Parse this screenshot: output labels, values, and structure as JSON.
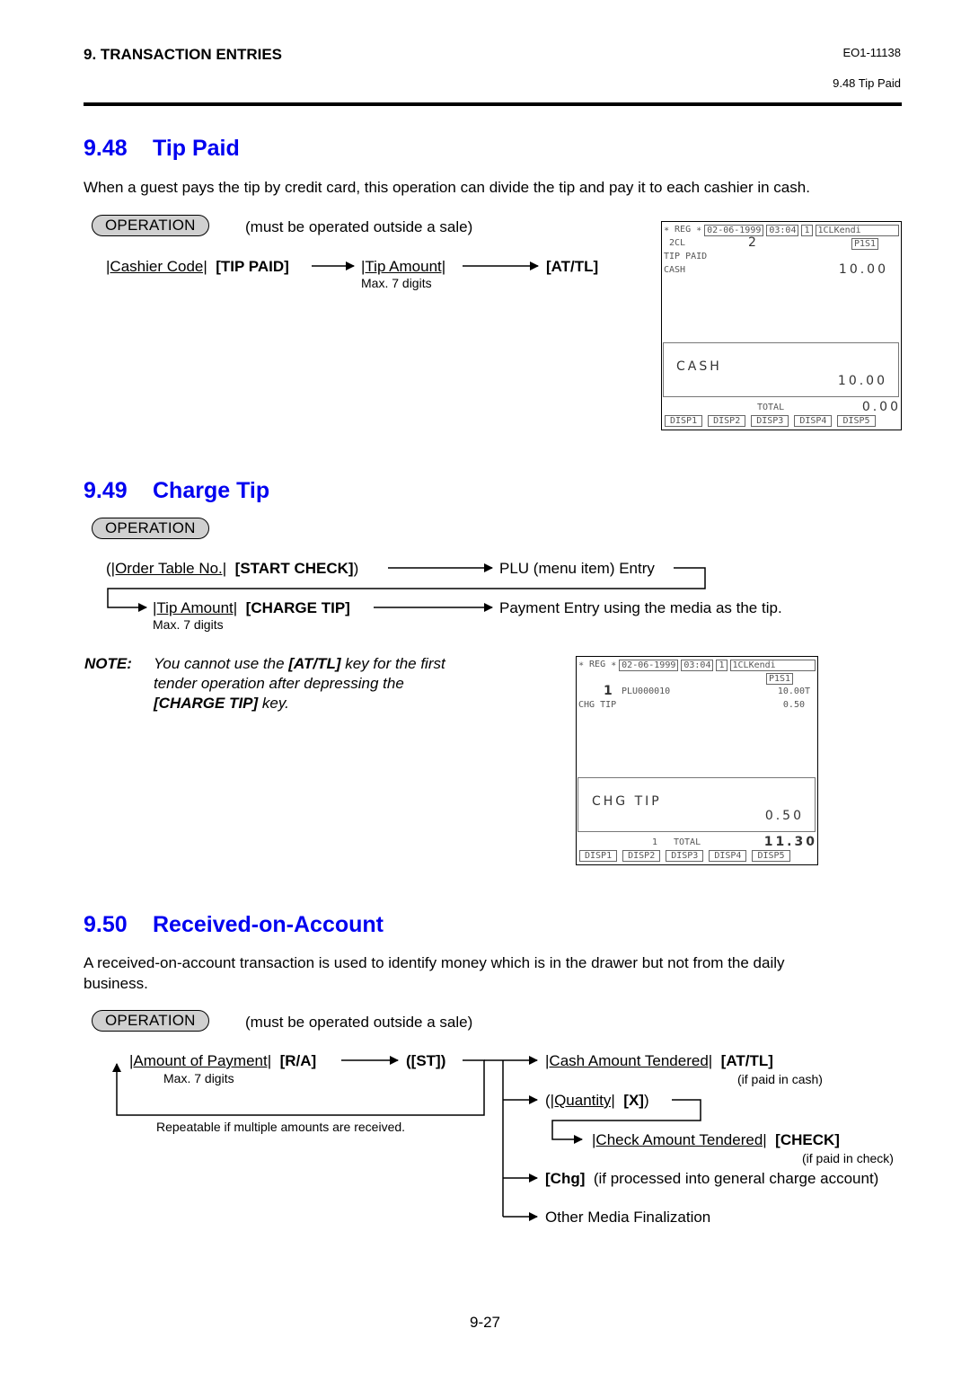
{
  "header": {
    "chapter": "9.  TRANSACTION ENTRIES",
    "doc_id": "EO1-11138",
    "section_ref": "9.48  Tip Paid"
  },
  "sections": {
    "tip_paid": {
      "number": "9.48",
      "title": "Tip Paid",
      "description": "When a guest pays the tip by credit card, this operation can divide the tip and pay it to each cashier in cash.",
      "operation_label": "OPERATION",
      "operation_note": "(must be operated outside a sale)",
      "flow": {
        "cashier_code": "|Cashier Code|",
        "tip_paid_key": "[TIP PAID]",
        "tip_amount": "|Tip Amount|",
        "max_digits": "Max. 7 digits",
        "at_tl_key": "[AT/TL]"
      },
      "screen": {
        "mode": "∗ REG ∗",
        "date": "02-06-1999",
        "time": "03:04",
        "terminal": "1",
        "cashier": "1CLKendi",
        "line1_left": "2CL",
        "line1_mid": "2",
        "line1_right": "P1S1",
        "line2": "TIP PAID",
        "line3_left": "CASH",
        "line3_right": "10.00",
        "lcd_label": "CASH",
        "lcd_value": "10.00",
        "total_label": "TOTAL",
        "total_value": "0.00",
        "disp_buttons": [
          "DISP1",
          "DISP2",
          "DISP3",
          "DISP4",
          "DISP5"
        ]
      }
    },
    "charge_tip": {
      "number": "9.49",
      "title": "Charge Tip",
      "operation_label": "OPERATION",
      "flow": {
        "open_paren": "(",
        "order_table": "|Order Table No.|",
        "start_check": "[START CHECK]",
        "close_paren": ")",
        "plu_entry": "PLU (menu item) Entry",
        "tip_amount": "|Tip Amount|",
        "charge_tip_key": "[CHARGE TIP]",
        "max_digits": "Max. 7 digits",
        "payment_entry": "Payment Entry using the media as the tip."
      },
      "note": {
        "label": "NOTE:",
        "line1_a": "You cannot use the ",
        "line1_key": "[AT/TL]",
        "line1_b": " key for the first",
        "line2": "tender operation after depressing the",
        "line3_key": "[CHARGE TIP]",
        "line3_b": " key."
      },
      "screen": {
        "mode": "∗ REG ∗",
        "date": "02-06-1999",
        "time": "03:04",
        "terminal": "1",
        "cashier": "1CLKendi",
        "line1_right": "P1S1",
        "item_qty": "1",
        "item_name": "PLU000010",
        "item_value": "10.00T",
        "line3_left": "CHG TIP",
        "line3_right": "0.50",
        "lcd_label": "CHG TIP",
        "lcd_value": "0.50",
        "total_count": "1",
        "total_label": "TOTAL",
        "total_value": "11.30",
        "disp_buttons": [
          "DISP1",
          "DISP2",
          "DISP3",
          "DISP4",
          "DISP5"
        ]
      }
    },
    "received_on_account": {
      "number": "9.50",
      "title": "Received-on-Account",
      "description_line1": "A received-on-account transaction is used to identify money which is in the drawer but not from the daily",
      "description_line2": "business.",
      "operation_label": "OPERATION",
      "operation_note": "(must be operated outside a sale)",
      "flow": {
        "amount_of_payment": "|Amount of Payment|",
        "ra_key": "[R/A]",
        "max_digits": "Max. 7 digits",
        "st_key": "([ST])",
        "repeat_note": "Repeatable if multiple amounts are received.",
        "cash_tendered": "|Cash Amount Tendered|",
        "at_tl_key": "[AT/TL]",
        "if_cash": "(if paid in cash)",
        "quantity_open": "(",
        "quantity": "|Quantity|",
        "x_key": "[X]",
        "quantity_close": ")",
        "check_tendered": "|Check Amount Tendered|",
        "check_key": "[CHECK]",
        "if_check": "(if paid in check)",
        "chg_key": "[Chg]",
        "chg_note": "(if processed into general charge account)",
        "other_media": "Other Media Finalization"
      }
    }
  },
  "footer": {
    "page_number": "9-27"
  },
  "colors": {
    "section_title": "#0000f0",
    "operation_pill": "#d0d0d0"
  }
}
